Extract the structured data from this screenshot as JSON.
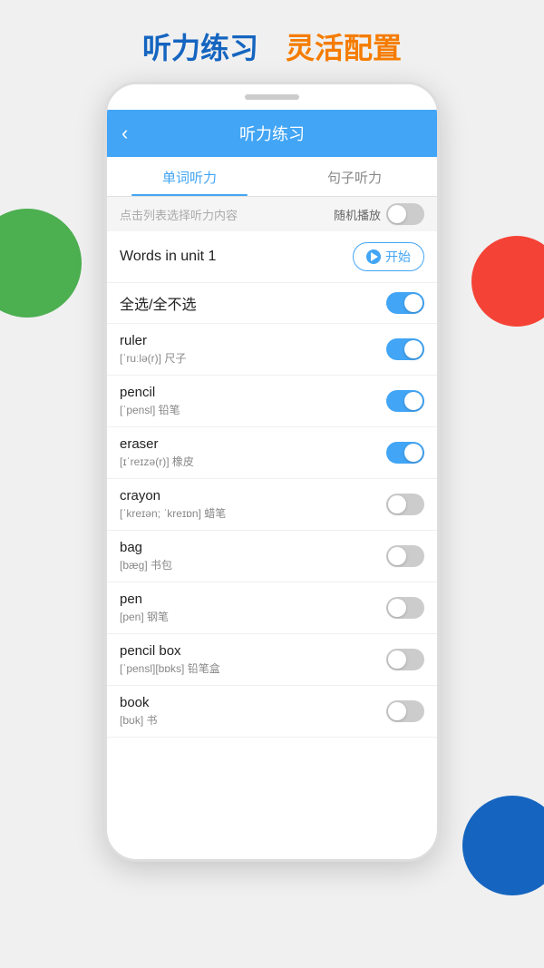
{
  "top_header": {
    "left_text": "听力练习",
    "right_text": "灵活配置"
  },
  "phone": {
    "app_header": {
      "back_icon": "‹",
      "title": "听力练习"
    },
    "tabs": [
      {
        "id": "word",
        "label": "单词听力",
        "active": true
      },
      {
        "id": "sentence",
        "label": "句子听力",
        "active": false
      }
    ],
    "subtitle_bar": {
      "hint_text": "点击列表选择听力内容",
      "random_play_label": "随机播放",
      "random_toggle": false
    },
    "unit_row": {
      "title": "Words in unit 1",
      "start_button_label": "开始"
    },
    "select_all_row": {
      "label": "全选/全不选",
      "toggle": true
    },
    "words": [
      {
        "en": "ruler",
        "phonetic": "[ˈruːlə(r)]",
        "cn": "尺子",
        "enabled": true
      },
      {
        "en": "pencil",
        "phonetic": "[ˈpensl]",
        "cn": "铅笔",
        "enabled": true
      },
      {
        "en": "eraser",
        "phonetic": "[ɪˈreɪzə(r)]",
        "cn": "橡皮",
        "enabled": true
      },
      {
        "en": "crayon",
        "phonetic": "[ˈkreɪən; ˈkreɪɒn]",
        "cn": "蜡笔",
        "enabled": false
      },
      {
        "en": "bag",
        "phonetic": "[bæɡ]",
        "cn": "书包",
        "enabled": false
      },
      {
        "en": "pen",
        "phonetic": "[pen]",
        "cn": "钢笔",
        "enabled": false
      },
      {
        "en": "pencil box",
        "phonetic": "[ˈpensl][bɒks]",
        "cn": "铅笔盒",
        "enabled": false
      },
      {
        "en": "book",
        "phonetic": "[bʊk]",
        "cn": "书",
        "enabled": false
      }
    ]
  },
  "colors": {
    "blue": "#42a5f5",
    "orange": "#f57c00",
    "dark_blue": "#1565c0",
    "green": "#4caf50",
    "red": "#f44336",
    "navy": "#1565c0"
  }
}
